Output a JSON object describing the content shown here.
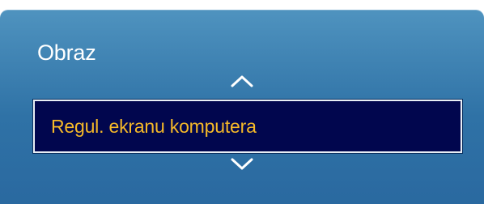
{
  "menu": {
    "title": "Obraz",
    "selected_item": "Regul. ekranu komputera"
  },
  "icons": {
    "up": "chevron-up-icon",
    "down": "chevron-down-icon"
  },
  "colors": {
    "panel_top": "#4f93bf",
    "panel_bottom": "#2a69a0",
    "selected_bg": "#01064e",
    "selected_text": "#f6b928",
    "title_text": "#ffffff"
  }
}
